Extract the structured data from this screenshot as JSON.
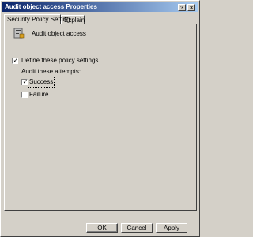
{
  "window": {
    "title": "Audit object access Properties"
  },
  "titlebar_buttons": {
    "help": "?",
    "close": "×"
  },
  "tabs": [
    {
      "label": "Security Policy Setting",
      "active": true
    },
    {
      "label": "Explain",
      "active": false
    }
  ],
  "policy": {
    "name": "Audit object access",
    "icon": "policy-icon"
  },
  "define": {
    "label": "Define these policy settings",
    "checked": true
  },
  "attempts": {
    "heading": "Audit these attempts:",
    "success": {
      "label": "Success",
      "checked": true
    },
    "failure": {
      "label": "Failure",
      "checked": false
    }
  },
  "buttons": {
    "ok": "OK",
    "cancel": "Cancel",
    "apply": "Apply"
  },
  "colors": {
    "title_start": "#0a246a",
    "title_end": "#a6caf0",
    "face": "#d4d0c8"
  }
}
